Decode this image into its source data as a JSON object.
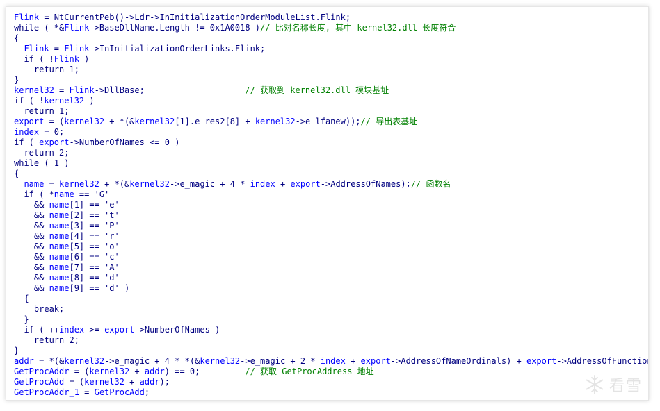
{
  "code": {
    "lines": [
      [
        [
          "v",
          "Flink"
        ],
        [
          "p",
          " = NtCurrentPeb()->Ldr->InInitializationOrderModuleList.Flink;"
        ]
      ],
      [
        [
          "p",
          "while ( *&"
        ],
        [
          "v",
          "Flink"
        ],
        [
          "p",
          "->BaseDllName.Length != 0x1A0018 )"
        ],
        [
          "c",
          "// 比对名称长度, 其中 kernel32.dll 长度符合"
        ]
      ],
      [
        [
          "p",
          "{"
        ]
      ],
      [
        [
          "p",
          "  "
        ],
        [
          "v",
          "Flink"
        ],
        [
          "p",
          " = "
        ],
        [
          "v",
          "Flink"
        ],
        [
          "p",
          "->InInitializationOrderLinks.Flink;"
        ]
      ],
      [
        [
          "p",
          "  if ( !"
        ],
        [
          "v",
          "Flink"
        ],
        [
          "p",
          " )"
        ]
      ],
      [
        [
          "p",
          "    return 1;"
        ]
      ],
      [
        [
          "p",
          "}"
        ]
      ],
      [
        [
          "v",
          "kernel32"
        ],
        [
          "p",
          " = "
        ],
        [
          "v",
          "Flink"
        ],
        [
          "p",
          "->DllBase;                    "
        ],
        [
          "c",
          "// 获取到 kernel32.dll 模块基址"
        ]
      ],
      [
        [
          "p",
          "if ( !"
        ],
        [
          "v",
          "kernel32"
        ],
        [
          "p",
          " )"
        ]
      ],
      [
        [
          "p",
          "  return 1;"
        ]
      ],
      [
        [
          "v",
          "export"
        ],
        [
          "p",
          " = ("
        ],
        [
          "v",
          "kernel32"
        ],
        [
          "p",
          " + *(&"
        ],
        [
          "v",
          "kernel32"
        ],
        [
          "p",
          "[1].e_res2[8] + "
        ],
        [
          "v",
          "kernel32"
        ],
        [
          "p",
          "->e_lfanew));"
        ],
        [
          "c",
          "// 导出表基址"
        ]
      ],
      [
        [
          "v",
          "index"
        ],
        [
          "p",
          " = 0;"
        ]
      ],
      [
        [
          "p",
          "if ( "
        ],
        [
          "v",
          "export"
        ],
        [
          "p",
          "->NumberOfNames <= 0 )"
        ]
      ],
      [
        [
          "p",
          "  return 2;"
        ]
      ],
      [
        [
          "p",
          "while ( 1 )"
        ]
      ],
      [
        [
          "p",
          "{"
        ]
      ],
      [
        [
          "p",
          "  "
        ],
        [
          "v",
          "name"
        ],
        [
          "p",
          " = "
        ],
        [
          "v",
          "kernel32"
        ],
        [
          "p",
          " + *(&"
        ],
        [
          "v",
          "kernel32"
        ],
        [
          "p",
          "->e_magic + 4 * "
        ],
        [
          "v",
          "index"
        ],
        [
          "p",
          " + "
        ],
        [
          "v",
          "export"
        ],
        [
          "p",
          "->AddressOfNames);"
        ],
        [
          "c",
          "// 函数名"
        ]
      ],
      [
        [
          "p",
          "  if ( *"
        ],
        [
          "v",
          "name"
        ],
        [
          "p",
          " == 'G'"
        ]
      ],
      [
        [
          "p",
          "    && "
        ],
        [
          "v",
          "name"
        ],
        [
          "p",
          "[1] == 'e'"
        ]
      ],
      [
        [
          "p",
          "    && "
        ],
        [
          "v",
          "name"
        ],
        [
          "p",
          "[2] == 't'"
        ]
      ],
      [
        [
          "p",
          "    && "
        ],
        [
          "v",
          "name"
        ],
        [
          "p",
          "[3] == 'P'"
        ]
      ],
      [
        [
          "p",
          "    && "
        ],
        [
          "v",
          "name"
        ],
        [
          "p",
          "[4] == 'r'"
        ]
      ],
      [
        [
          "p",
          "    && "
        ],
        [
          "v",
          "name"
        ],
        [
          "p",
          "[5] == 'o'"
        ]
      ],
      [
        [
          "p",
          "    && "
        ],
        [
          "v",
          "name"
        ],
        [
          "p",
          "[6] == 'c'"
        ]
      ],
      [
        [
          "p",
          "    && "
        ],
        [
          "v",
          "name"
        ],
        [
          "p",
          "[7] == 'A'"
        ]
      ],
      [
        [
          "p",
          "    && "
        ],
        [
          "v",
          "name"
        ],
        [
          "p",
          "[8] == 'd'"
        ]
      ],
      [
        [
          "p",
          "    && "
        ],
        [
          "v",
          "name"
        ],
        [
          "p",
          "[9] == 'd' )"
        ]
      ],
      [
        [
          "p",
          "  {"
        ]
      ],
      [
        [
          "p",
          "    break;"
        ]
      ],
      [
        [
          "p",
          "  }"
        ]
      ],
      [
        [
          "p",
          "  if ( ++"
        ],
        [
          "v",
          "index"
        ],
        [
          "p",
          " >= "
        ],
        [
          "v",
          "export"
        ],
        [
          "p",
          "->NumberOfNames )"
        ]
      ],
      [
        [
          "p",
          "    return 2;"
        ]
      ],
      [
        [
          "p",
          "}"
        ]
      ],
      [
        [
          "v",
          "addr"
        ],
        [
          "p",
          " = *(&"
        ],
        [
          "v",
          "kernel32"
        ],
        [
          "p",
          "->e_magic + 4 * *(&"
        ],
        [
          "v",
          "kernel32"
        ],
        [
          "p",
          "->e_magic + 2 * "
        ],
        [
          "v",
          "index"
        ],
        [
          "p",
          " + "
        ],
        [
          "v",
          "export"
        ],
        [
          "p",
          "->AddressOfNameOrdinals) + "
        ],
        [
          "v",
          "export"
        ],
        [
          "p",
          "->AddressOfFunctions);"
        ]
      ],
      [
        [
          "v",
          "GetProcAddr"
        ],
        [
          "p",
          " = ("
        ],
        [
          "v",
          "kernel32"
        ],
        [
          "p",
          " + "
        ],
        [
          "v",
          "addr"
        ],
        [
          "p",
          ") == 0;         "
        ],
        [
          "c",
          "// 获取 GetProcAddress 地址"
        ]
      ],
      [
        [
          "v",
          "GetProcAdd"
        ],
        [
          "p",
          " = ("
        ],
        [
          "v",
          "kernel32"
        ],
        [
          "p",
          " + "
        ],
        [
          "v",
          "addr"
        ],
        [
          "p",
          ");"
        ]
      ],
      [
        [
          "v",
          "GetProcAddr_1"
        ],
        [
          "p",
          " = "
        ],
        [
          "v",
          "GetProcAdd"
        ],
        [
          "p",
          ";"
        ]
      ]
    ]
  },
  "colors": {
    "plain": "#000080",
    "variable": "#0000ff",
    "comment": "#008000"
  },
  "watermark": {
    "text": "看雪",
    "icon": "snowflake-icon"
  }
}
